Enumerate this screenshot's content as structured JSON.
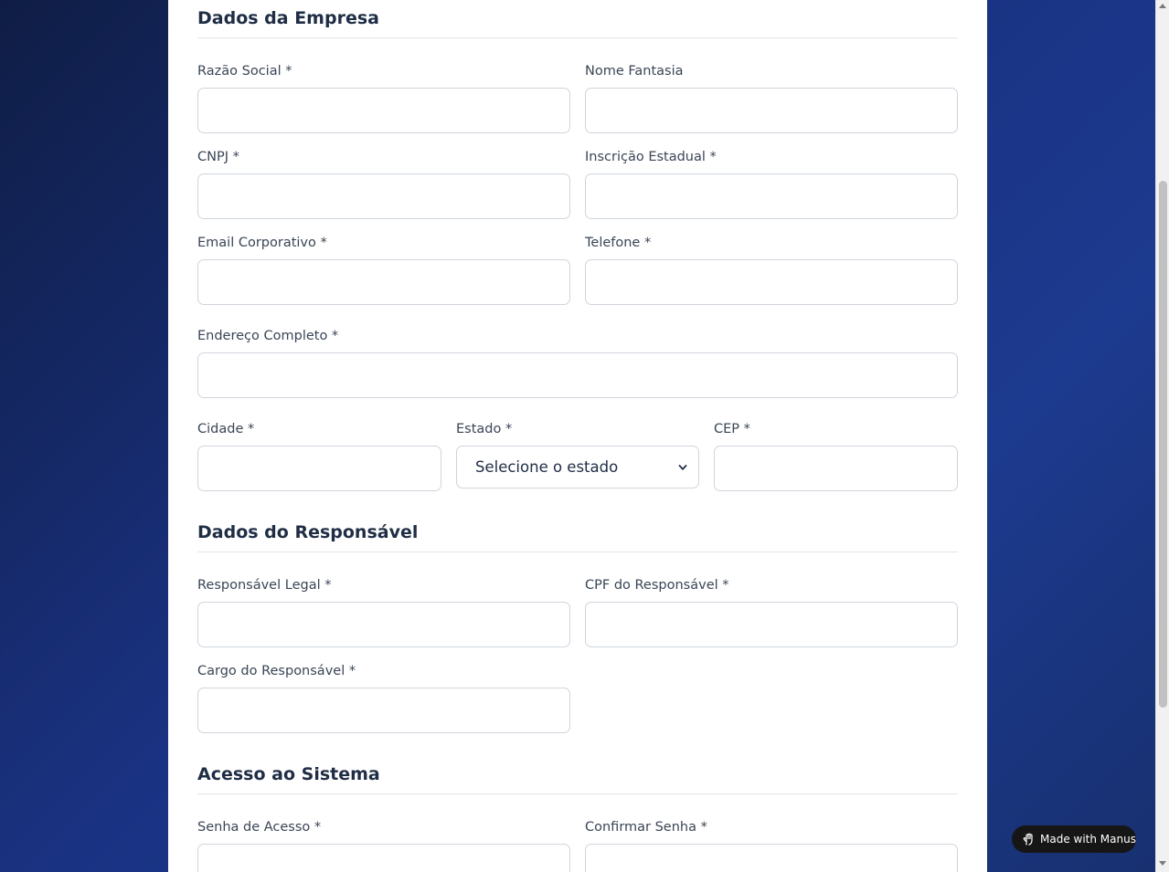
{
  "sections": {
    "empresa": {
      "title": "Dados da Empresa",
      "fields": {
        "razao_social": "Razão Social *",
        "nome_fantasia": "Nome Fantasia",
        "cnpj": "CNPJ *",
        "inscricao_estadual": "Inscrição Estadual *",
        "email_corporativo": "Email Corporativo *",
        "telefone": "Telefone *",
        "endereco_completo": "Endereço Completo *",
        "cidade": "Cidade *",
        "estado": "Estado *",
        "cep": "CEP *"
      },
      "estado_select_value": "Selecione o estado"
    },
    "responsavel": {
      "title": "Dados do Responsável",
      "fields": {
        "responsavel_legal": "Responsável Legal *",
        "cpf_responsavel": "CPF do Responsável *",
        "cargo_responsavel": "Cargo do Responsável *"
      }
    },
    "acesso": {
      "title": "Acesso ao Sistema",
      "fields": {
        "senha": "Senha de Acesso *",
        "confirmar_senha": "Confirmar Senha *"
      }
    }
  },
  "badge": {
    "label": "Made with Manus",
    "icon": "manus-hand-icon"
  },
  "colors": {
    "background_gradient_start": "#0f1d45",
    "background_gradient_end": "#1c3a8f",
    "card": "#ffffff",
    "heading": "#1f2d45",
    "label": "#3a4556",
    "field_border": "#cfd5dd",
    "badge_bg": "#161616"
  }
}
